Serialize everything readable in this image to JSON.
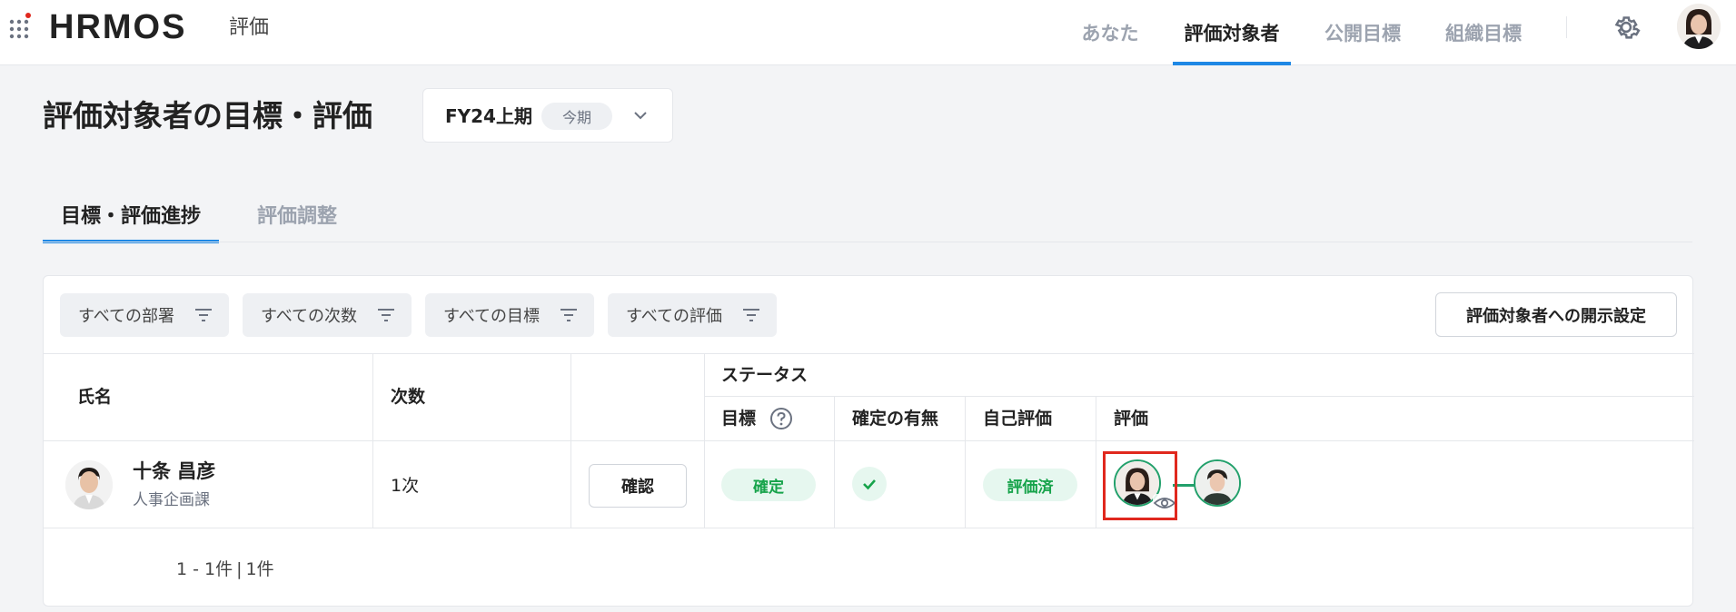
{
  "app": {
    "logo": "HRMOS",
    "module": "評価"
  },
  "nav": {
    "items": [
      {
        "label": "あなた",
        "active": false
      },
      {
        "label": "評価対象者",
        "active": true
      },
      {
        "label": "公開目標",
        "active": false
      },
      {
        "label": "組織目標",
        "active": false
      }
    ]
  },
  "page": {
    "title": "評価対象者の目標・評価",
    "period": {
      "label": "FY24上期",
      "badge": "今期"
    }
  },
  "tabs": [
    {
      "label": "目標・評価進捗",
      "active": true
    },
    {
      "label": "評価調整",
      "active": false
    }
  ],
  "filters": [
    {
      "label": "すべての部署"
    },
    {
      "label": "すべての次数"
    },
    {
      "label": "すべての目標"
    },
    {
      "label": "すべての評価"
    }
  ],
  "disclose_button": "評価対象者への開示設定",
  "table": {
    "headers": {
      "name": "氏名",
      "order": "次数",
      "status": "ステータス",
      "goal": "目標",
      "confirmed": "確定の有無",
      "self_eval": "自己評価",
      "eval": "評価"
    },
    "rows": [
      {
        "name": "十条 昌彦",
        "dept": "人事企画課",
        "order": "1次",
        "action": "確認",
        "goal_status": "確定",
        "self_eval_status": "評価済"
      }
    ]
  },
  "pagination": {
    "range": "1 - 1件",
    "total": "1件"
  },
  "colors": {
    "accent": "#1e88e5",
    "success": "#16a34a",
    "success_bg": "#e6f7ef",
    "highlight": "#e0281e"
  }
}
